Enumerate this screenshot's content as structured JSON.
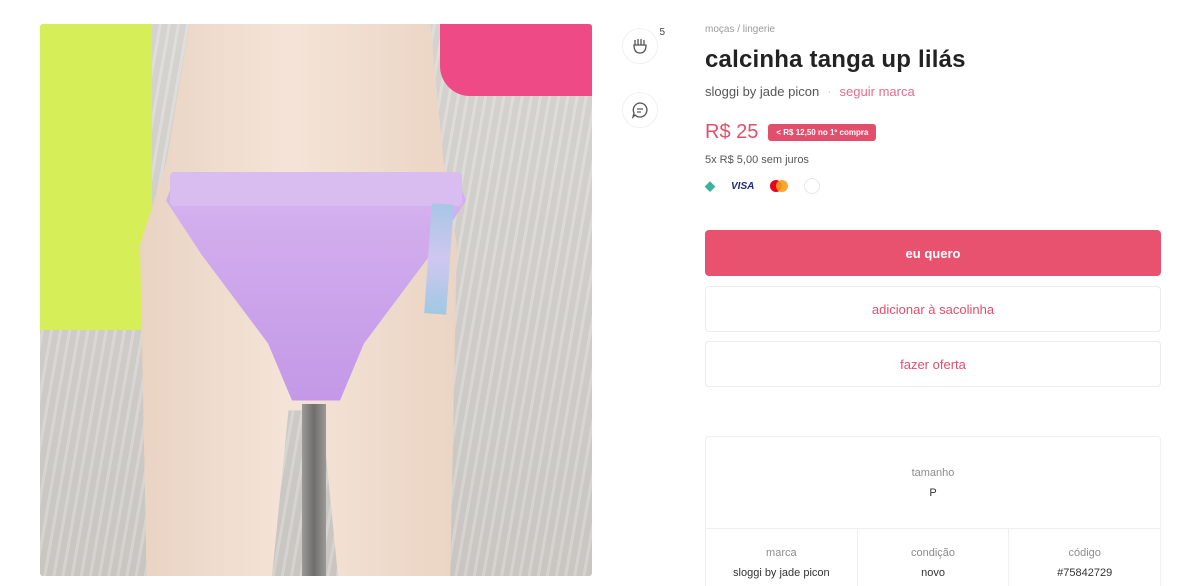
{
  "product": {
    "breadcrumb": "moças / lingerie",
    "title": "calcinha tanga up lilás",
    "brand": "sloggi by jade picon",
    "follow_label": "seguir marca",
    "price": "R$ 25",
    "discount": "< R$ 12,50 no 1º compra",
    "installments": "5x R$ 5,00 sem juros",
    "likes": "5"
  },
  "payments": {
    "pix": "◆",
    "visa": "VISA"
  },
  "actions": {
    "buy_label": "eu quero",
    "add_to_bag_label": "adicionar à sacolinha",
    "offer_label": "fazer oferta"
  },
  "details": {
    "size_label": "tamanho",
    "size_value": "P",
    "brand_label": "marca",
    "brand_value": "sloggi by jade picon",
    "condition_label": "condição",
    "condition_value": "novo",
    "code_label": "código",
    "code_value": "#75842729"
  },
  "icons": {
    "like": "like-icon",
    "chat": "chat-icon"
  },
  "colors": {
    "accent": "#e9526e",
    "price": "#e14f6d"
  }
}
